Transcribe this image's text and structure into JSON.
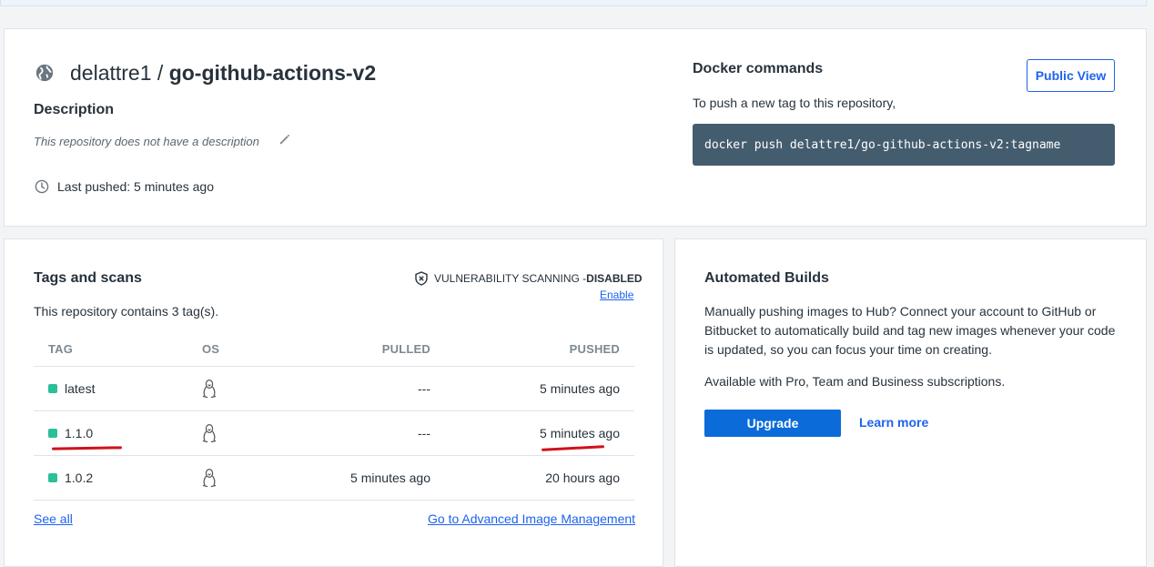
{
  "repo": {
    "owner": "delattre1",
    "separator": " / ",
    "name": "go-github-actions-v2",
    "description_heading": "Description",
    "description_text": "This repository does not have a description",
    "last_pushed": "Last pushed: 5 minutes ago"
  },
  "docker": {
    "heading": "Docker commands",
    "subtext": "To push a new tag to this repository,",
    "command": "docker push delattre1/go-github-actions-v2:tagname",
    "public_view_label": "Public View"
  },
  "tags": {
    "heading": "Tags and scans",
    "vuln_label": "VULNERABILITY SCANNING - ",
    "vuln_state": "DISABLED",
    "enable_label": "Enable",
    "count_text": "This repository contains 3 tag(s).",
    "columns": {
      "tag": "TAG",
      "os": "OS",
      "pulled": "PULLED",
      "pushed": "PUSHED"
    },
    "rows": [
      {
        "tag": "latest",
        "os": "linux-icon",
        "pulled": "---",
        "pushed": "5 minutes ago"
      },
      {
        "tag": "1.1.0",
        "os": "linux-icon",
        "pulled": "---",
        "pushed": "5 minutes ago"
      },
      {
        "tag": "1.0.2",
        "os": "linux-icon",
        "pulled": "5 minutes ago",
        "pushed": "20 hours ago"
      }
    ],
    "see_all": "See all",
    "advanced_link": "Go to Advanced Image Management",
    "status_color": "#2bbf9a",
    "annotation_color": "#d0111b"
  },
  "builds": {
    "heading": "Automated Builds",
    "paragraph": "Manually pushing images to Hub? Connect your account to GitHub or Bitbucket to automatically build and tag new images whenever your code is updated, so you can focus your time on creating.",
    "availability": "Available with Pro, Team and Business subscriptions.",
    "upgrade_label": "Upgrade",
    "learn_more_label": "Learn more"
  },
  "colors": {
    "accent": "#1d63ed",
    "button": "#0b6bd9",
    "command_bg": "#445d6e"
  }
}
